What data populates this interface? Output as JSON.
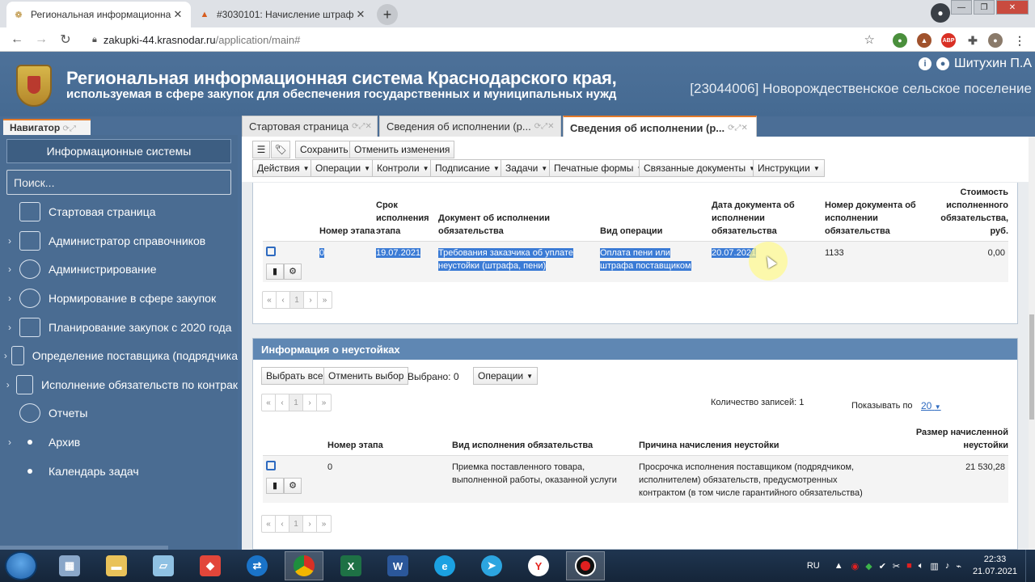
{
  "browser": {
    "tabs": [
      {
        "title": "Региональная информационна",
        "active": true
      },
      {
        "title": "#3030101: Начисление штрафа",
        "active": false
      }
    ],
    "url_host": "zakupki-44.krasnodar.ru",
    "url_path": "/application/main#",
    "extensions": [
      "green-ext-icon",
      "hat-ext-icon",
      "adblock-icon",
      "puzzle-icon",
      "avatar"
    ]
  },
  "header": {
    "title": "Региональная информационная система Краснодарского края,",
    "subtitle": "используемая в сфере закупок для обеспечения государственных и муниципальных нужд",
    "user": "Шитухин П.А",
    "org": "[23044006] Новорождественское сельское поселение"
  },
  "navigator": {
    "tab_label": "Навигатор",
    "is_button": "Информационные системы",
    "search_placeholder": "Поиск...",
    "items": [
      {
        "label": "Стартовая страница",
        "expandable": false,
        "icon": "home-icon"
      },
      {
        "label": "Администратор справочников",
        "expandable": true,
        "icon": "document-icon"
      },
      {
        "label": "Администрирование",
        "expandable": true,
        "icon": "gear-icon"
      },
      {
        "label": "Нормирование в сфере закупок",
        "expandable": true,
        "icon": "user-icon"
      },
      {
        "label": "Планирование закупок с 2020 года",
        "expandable": true,
        "icon": "calendar-icon"
      },
      {
        "label": "Определение поставщика (подрядчика",
        "expandable": true,
        "icon": "building-icon"
      },
      {
        "label": "Исполнение обязательств по контрак",
        "expandable": true,
        "icon": "briefcase-icon"
      },
      {
        "label": "Отчеты",
        "expandable": false,
        "icon": "pie-chart-icon"
      },
      {
        "label": "Архив",
        "expandable": true,
        "icon": "dot-icon"
      },
      {
        "label": "Календарь задач",
        "expandable": false,
        "icon": "dot-icon"
      }
    ]
  },
  "content_tabs": [
    {
      "label": "Стартовая страница",
      "active": false
    },
    {
      "label": "Сведения об исполнении (р...",
      "active": false
    },
    {
      "label": "Сведения об исполнении (р...",
      "active": true
    }
  ],
  "toolbar": {
    "save": "Сохранить",
    "cancel": "Отменить изменения",
    "menus": [
      "Действия",
      "Операции",
      "Контроли",
      "Подписание",
      "Задачи",
      "Печатные формы",
      "Связанные документы",
      "Инструкции"
    ]
  },
  "stages_table": {
    "headers": [
      "Номер этапа",
      "Срок исполнения этапа",
      "Документ об исполнении обязательства",
      "Вид операции",
      "Дата документа об исполнении обязательства",
      "Номер документа об исполнении обязательства",
      "Стоимость исполненного обязательства, руб."
    ],
    "row": {
      "stage": "0",
      "deadline": "19.07.2021",
      "document": "Требования заказчика об уплате неустойки (штрафа, пени)",
      "operation": "Оплата пени или штрафа поставщиком",
      "doc_date": "20.07.2021",
      "doc_number": "1133",
      "cost": "0,00"
    },
    "pager": [
      "«",
      "‹",
      "1",
      "›",
      "»"
    ]
  },
  "penalties": {
    "title": "Информация о неустойках",
    "select_all": "Выбрать все",
    "deselect": "Отменить выбор",
    "selected": "Выбрано: 0",
    "operations": "Операции",
    "record_count": "Количество записей: 1",
    "show_per_page_label": "Показывать по",
    "show_per_page_value": "20",
    "headers": [
      "Номер этапа",
      "Вид исполнения обязательства",
      "Причина начисления неустойки",
      "Размер начисленной неустойки"
    ],
    "row": {
      "stage": "0",
      "kind": "Приемка поставленного товара, выполненной работы, оказанной услуги",
      "reason": "Просрочка исполнения поставщиком (подрядчиком, исполнителем) обязательств, предусмотренных контрактом (в том числе гарантийного обязательства)",
      "amount": "21 530,28"
    }
  },
  "taskbar": {
    "lang": "RU",
    "time": "22:33",
    "date": "21.07.2021"
  }
}
